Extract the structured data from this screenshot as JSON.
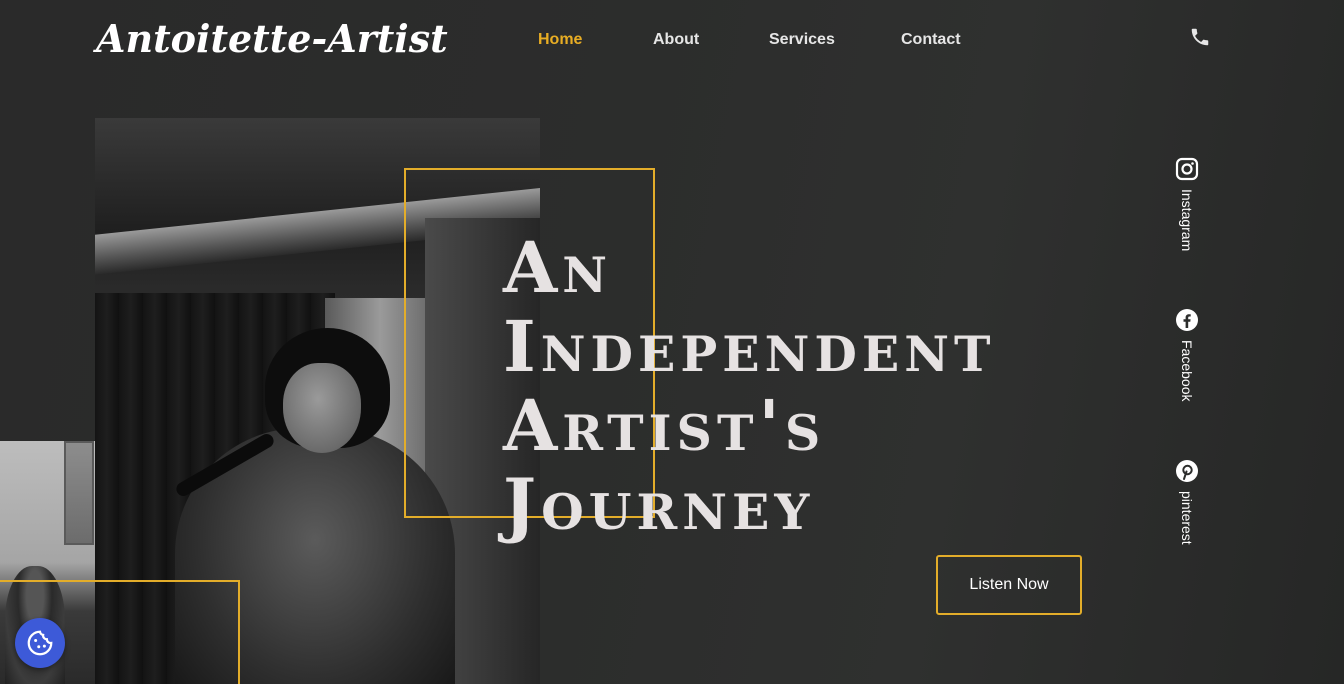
{
  "brand": {
    "logo": "Antoitette-Artist"
  },
  "nav": {
    "items": [
      {
        "label": "Home",
        "active": true
      },
      {
        "label": "About",
        "active": false
      },
      {
        "label": "Services",
        "active": false
      },
      {
        "label": "Contact",
        "active": false
      }
    ],
    "phone_icon": "phone-icon"
  },
  "hero": {
    "headline_lines": [
      "An",
      "Independent",
      "Artist's",
      "Journey"
    ],
    "cta_label": "Listen Now"
  },
  "social": [
    {
      "label": "Instagram",
      "icon": "instagram-icon"
    },
    {
      "label": "Facebook",
      "icon": "facebook-icon"
    },
    {
      "label": "pinterest",
      "icon": "pinterest-icon"
    }
  ],
  "colors": {
    "accent": "#e3ad2a",
    "nav_active": "#e8ad24",
    "background": "#2c2d2c",
    "headline": "#e6e2e2",
    "cookie_button": "#3d5ad8"
  },
  "cookie": {
    "icon": "cookie-icon"
  }
}
